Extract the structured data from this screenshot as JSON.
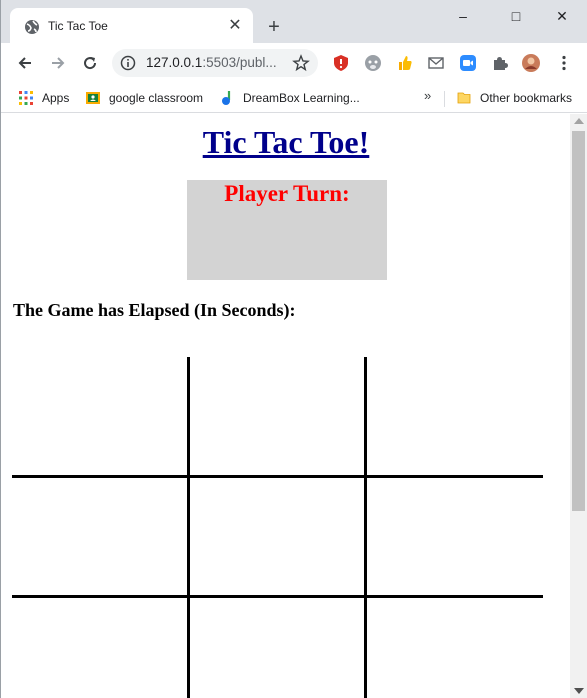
{
  "browser": {
    "tab": {
      "title": "Tic Tac Toe",
      "favicon": "globe-icon"
    },
    "new_tab_label": "+",
    "window_controls": {
      "minimize": "–",
      "maximize": "□",
      "close": "✕"
    },
    "address_bar": {
      "host": "127.0.0.1",
      "rest": ":5503/publ..."
    },
    "bookmarks": [
      {
        "label": "Apps",
        "icon": "apps-grid-icon"
      },
      {
        "label": "google classroom",
        "icon": "classroom-icon"
      },
      {
        "label": "DreamBox Learning...",
        "icon": "dreambox-icon"
      }
    ],
    "bookmarks_more": "»",
    "other_bookmarks": "Other bookmarks"
  },
  "page": {
    "title": "Tic Tac Toe!",
    "turn_label": "Player Turn:",
    "timer_label": "The Game has Elapsed (In Seconds):",
    "board": [
      "",
      "",
      "",
      "",
      "",
      "",
      "",
      "",
      ""
    ]
  },
  "colors": {
    "title": "#00008b",
    "turn_text": "#ff0000",
    "turn_box": "#d3d3d3"
  }
}
